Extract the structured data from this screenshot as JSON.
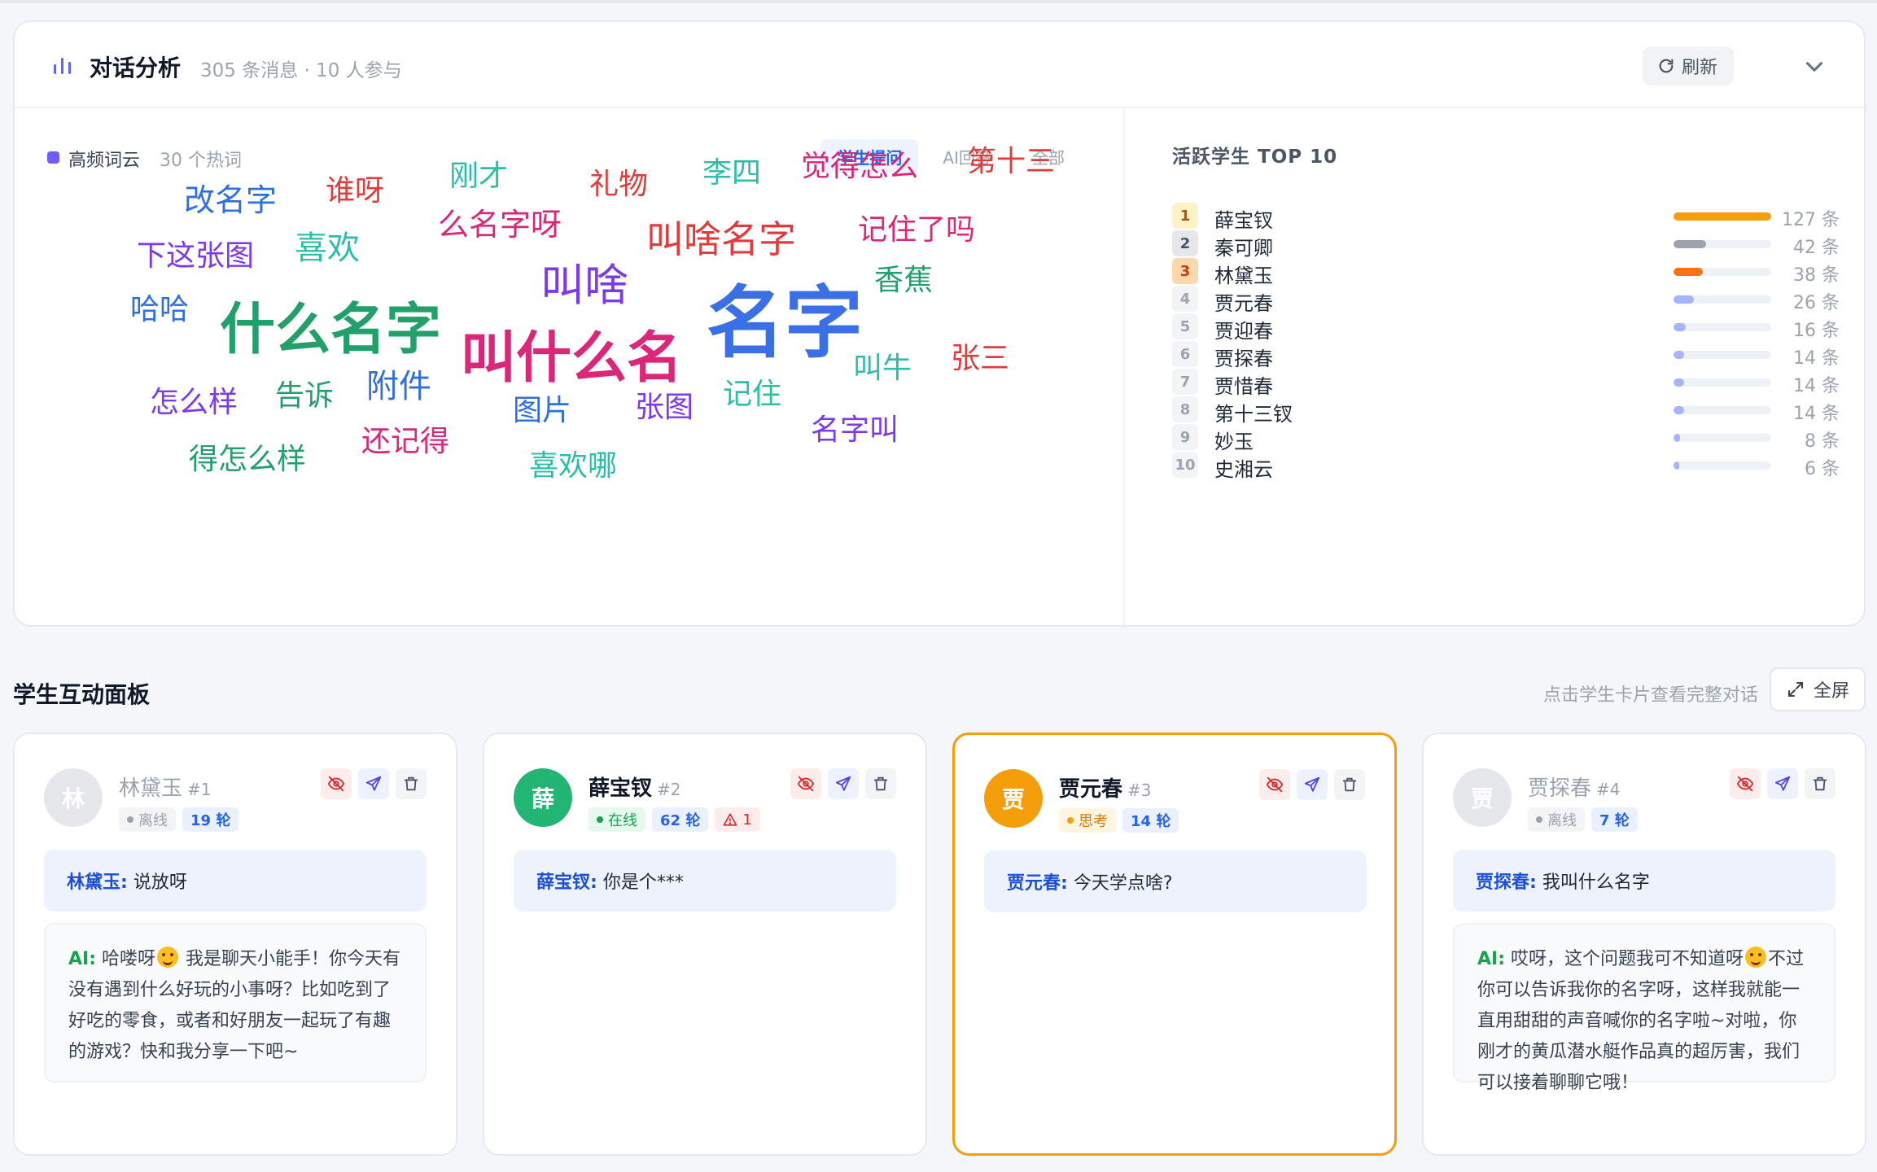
{
  "analysis": {
    "title": "对话分析",
    "subtitle": "305 条消息 · 10 人参与",
    "refresh_label": "刷新",
    "wordcloud": {
      "label": "高频词云",
      "count_text": "30 个热词",
      "tabs": [
        "学生提问",
        "AI回答",
        "全部"
      ],
      "active_tab": "学生提问",
      "words": [
        {
          "text": "名字",
          "color": "#3b6fe6"
        },
        {
          "text": "叫什么名",
          "color": "#db2777"
        },
        {
          "text": "什么名字",
          "color": "#22a06b"
        },
        {
          "text": "叫啥",
          "color": "#7c3aed"
        },
        {
          "text": "叫啥名字",
          "color": "#e23b3b"
        },
        {
          "text": "改名字",
          "color": "#2f6fe0"
        },
        {
          "text": "谁呀",
          "color": "#e23b3b"
        },
        {
          "text": "刚才",
          "color": "#2cbfa8"
        },
        {
          "text": "礼物",
          "color": "#e23b3b"
        },
        {
          "text": "李四",
          "color": "#2cbfa8"
        },
        {
          "text": "觉得怎么",
          "color": "#db2777"
        },
        {
          "text": "第十三",
          "color": "#e23b3b"
        },
        {
          "text": "么名字呀",
          "color": "#db2777"
        },
        {
          "text": "记住了吗",
          "color": "#db2777"
        },
        {
          "text": "下这张图",
          "color": "#7c3aed"
        },
        {
          "text": "喜欢",
          "color": "#2cbfa8"
        },
        {
          "text": "香蕉",
          "color": "#22a06b"
        },
        {
          "text": "哈哈",
          "color": "#2f6fe0"
        },
        {
          "text": "叫牛",
          "color": "#2cbfa8"
        },
        {
          "text": "张三",
          "color": "#e23b3b"
        },
        {
          "text": "怎么样",
          "color": "#7c3aed"
        },
        {
          "text": "告诉",
          "color": "#22a06b"
        },
        {
          "text": "附件",
          "color": "#2f6fe0"
        },
        {
          "text": "图片",
          "color": "#2f6fe0"
        },
        {
          "text": "张图",
          "color": "#7c3aed"
        },
        {
          "text": "记住",
          "color": "#2cbfa8"
        },
        {
          "text": "名字叫",
          "color": "#7c3aed"
        },
        {
          "text": "得怎么样",
          "color": "#22a06b"
        },
        {
          "text": "还记得",
          "color": "#db2777"
        },
        {
          "text": "喜欢哪",
          "color": "#2cbfa8"
        }
      ]
    },
    "top_students": {
      "title": "活跃学生 TOP 10",
      "unit": "条",
      "max": 127,
      "items": [
        {
          "rank": "1",
          "name": "薛宝钗",
          "count": 127,
          "count_text": "127 条",
          "color": "#f59e0b",
          "badge_bg": "#fef3c7",
          "badge_fg": "#b45309"
        },
        {
          "rank": "2",
          "name": "秦可卿",
          "count": 42,
          "count_text": "42 条",
          "color": "#9ca3af",
          "badge_bg": "#e5e7eb",
          "badge_fg": "#4b5563"
        },
        {
          "rank": "3",
          "name": "林黛玉",
          "count": 38,
          "count_text": "38 条",
          "color": "#f97316",
          "badge_bg": "#fed7aa",
          "badge_fg": "#c2410c"
        },
        {
          "rank": "4",
          "name": "贾元春",
          "count": 26,
          "count_text": "26 条",
          "color": "#a5b4fc",
          "badge_bg": "#f3f4f6",
          "badge_fg": "#9ca3af"
        },
        {
          "rank": "5",
          "name": "贾迎春",
          "count": 16,
          "count_text": "16 条",
          "color": "#a5b4fc",
          "badge_bg": "#f3f4f6",
          "badge_fg": "#9ca3af"
        },
        {
          "rank": "6",
          "name": "贾探春",
          "count": 14,
          "count_text": "14 条",
          "color": "#a5b4fc",
          "badge_bg": "#f3f4f6",
          "badge_fg": "#9ca3af"
        },
        {
          "rank": "7",
          "name": "贾惜春",
          "count": 14,
          "count_text": "14 条",
          "color": "#a5b4fc",
          "badge_bg": "#f3f4f6",
          "badge_fg": "#9ca3af"
        },
        {
          "rank": "8",
          "name": "第十三钗",
          "count": 14,
          "count_text": "14 条",
          "color": "#a5b4fc",
          "badge_bg": "#f3f4f6",
          "badge_fg": "#9ca3af"
        },
        {
          "rank": "9",
          "name": "妙玉",
          "count": 8,
          "count_text": "8 条",
          "color": "#a5b4fc",
          "badge_bg": "#f3f4f6",
          "badge_fg": "#9ca3af"
        },
        {
          "rank": "10",
          "name": "史湘云",
          "count": 6,
          "count_text": "6 条",
          "color": "#a5b4fc",
          "badge_bg": "#f3f4f6",
          "badge_fg": "#9ca3af"
        }
      ]
    }
  },
  "interaction": {
    "title": "学生互动面板",
    "hint": "点击学生卡片查看完整对话",
    "fullscreen_label": "全屏",
    "cards": [
      {
        "avatar": "林",
        "avatar_color": "#e5e7eb",
        "name": "林黛玉",
        "num": "#1",
        "status": "离线",
        "rounds": "19 轮",
        "user_name": "林黛玉:",
        "user_msg": "说放呀",
        "ai_label": "AI:",
        "ai_before": "哈喽呀",
        "ai_after": " 我是聊天小能手！你今天有没有遇到什么好玩的小事呀？比如吃到了好吃的零食，或者和好朋友一起玩了有趣的游戏？快和我分享一下吧~"
      },
      {
        "avatar": "薛",
        "avatar_color": "#22b573",
        "name": "薛宝钗",
        "num": "#2",
        "status": "在线",
        "rounds": "62 轮",
        "warn": "1",
        "user_name": "薛宝钗:",
        "user_msg": "你是个***"
      },
      {
        "avatar": "贾",
        "avatar_color": "#f59e0b",
        "name": "贾元春",
        "num": "#3",
        "status": "思考",
        "rounds": "14 轮",
        "user_name": "贾元春:",
        "user_msg": "今天学点啥?"
      },
      {
        "avatar": "贾",
        "avatar_color": "#e5e7eb",
        "name": "贾探春",
        "num": "#4",
        "status": "离线",
        "rounds": "7 轮",
        "user_name": "贾探春:",
        "user_msg": "我叫什么名字",
        "ai_label": "AI:",
        "ai_before": "哎呀，这个问题我可不知道呀",
        "ai_after": "不过你可以告诉我你的名字呀，这样我就能一直用甜甜的声音喊你的名字啦~对啦，你刚才的黄瓜潜水艇作品真的超厉害，我们可以接着聊聊它哦！"
      }
    ]
  }
}
